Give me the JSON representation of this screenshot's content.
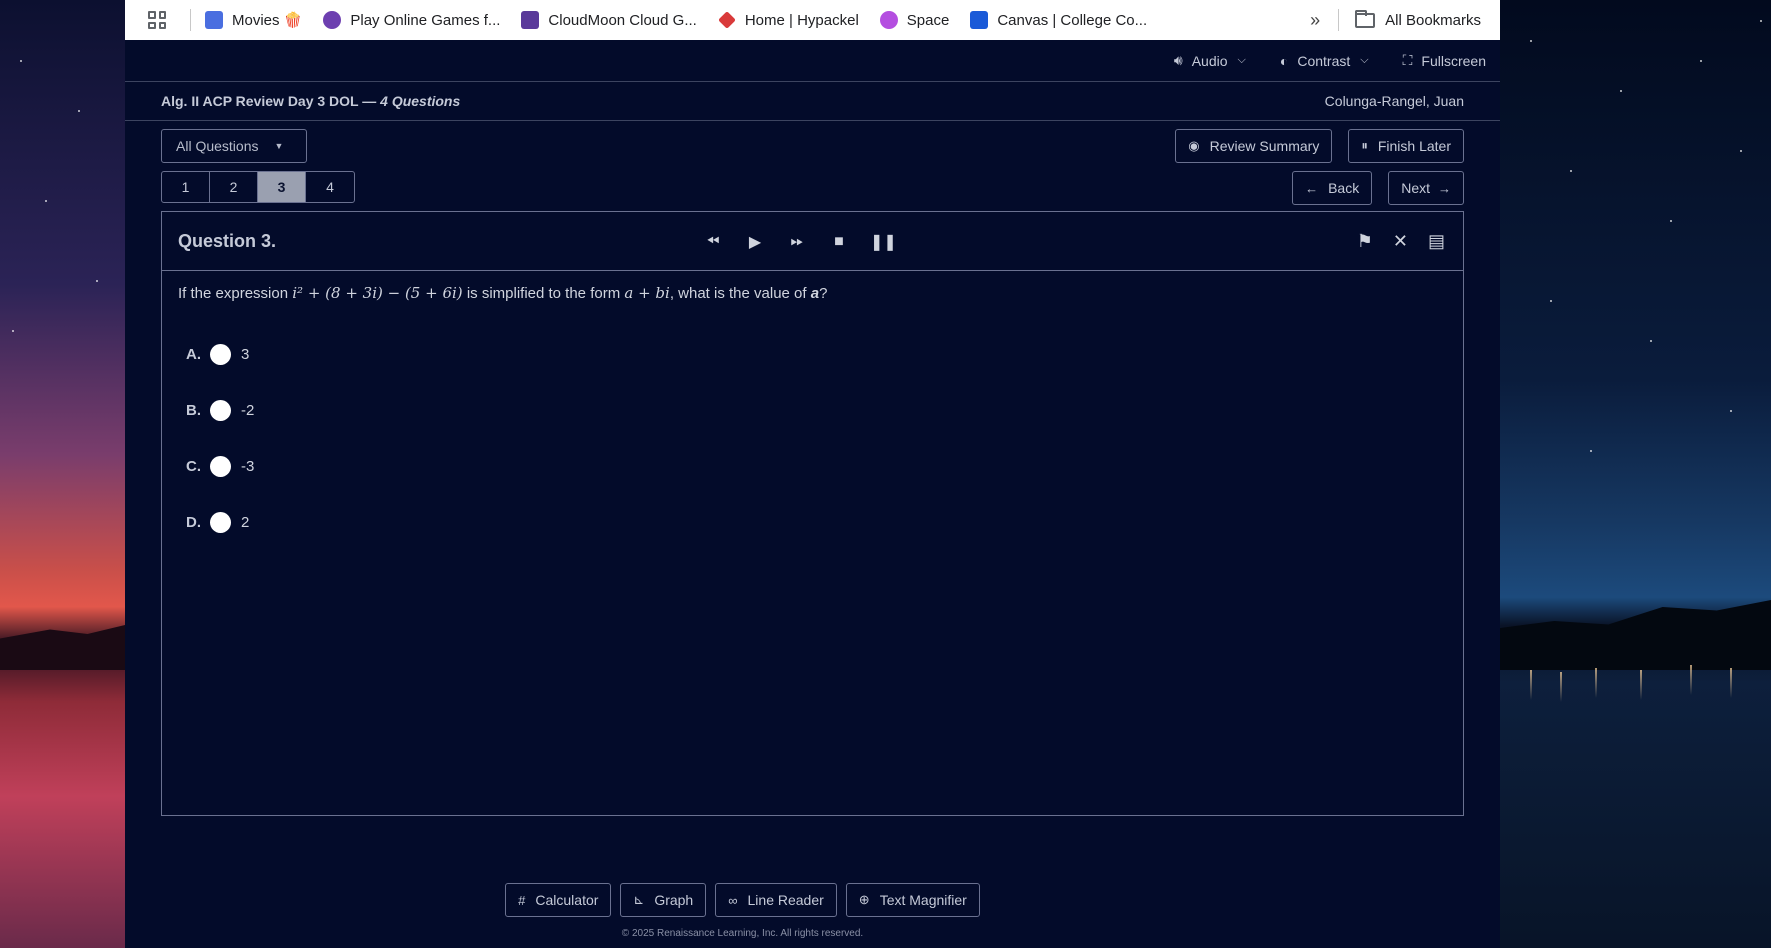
{
  "bookmarks": {
    "items": [
      {
        "label": "Movies 🍿",
        "color": "#4a6ee0"
      },
      {
        "label": "Play Online Games f...",
        "color": "#6d3fb0"
      },
      {
        "label": "CloudMoon Cloud G...",
        "color": "#5a3a9a"
      },
      {
        "label": "Home | Hypackel",
        "color": "#d93a3a"
      },
      {
        "label": "Space",
        "color": "#b44ee0"
      },
      {
        "label": "Canvas | College Co...",
        "color": "#1a5ad8"
      }
    ],
    "more": "»",
    "all_bookmarks": "All Bookmarks"
  },
  "topbar": {
    "audio": "Audio",
    "contrast": "Contrast",
    "fullscreen": "Fullscreen"
  },
  "titlebar": {
    "quiz_name": "Alg. II ACP Review Day 3 DOL — ",
    "question_count": "4 Questions",
    "student": "Colunga-Rangel, Juan"
  },
  "controls": {
    "filter": "All Questions",
    "review_summary": "Review Summary",
    "finish_later": "Finish Later",
    "back": "Back",
    "next": "Next"
  },
  "question_numbers": [
    "1",
    "2",
    "3",
    "4"
  ],
  "current_question": "3",
  "question": {
    "title": "Question 3.",
    "text_prefix": "If the expression",
    "expression": "i² + (8 + 3i) − (5 + 6i)",
    "text_middle": "is simplified to the form",
    "form": "a + bi",
    "text_suffix": ", what is the value of",
    "variable": "a",
    "end": "?",
    "options": [
      {
        "letter": "A.",
        "value": "3"
      },
      {
        "letter": "B.",
        "value": "-2"
      },
      {
        "letter": "C.",
        "value": "-3"
      },
      {
        "letter": "D.",
        "value": "2"
      }
    ]
  },
  "tools": {
    "calculator": "Calculator",
    "graph": "Graph",
    "line_reader": "Line Reader",
    "text_magnifier": "Text Magnifier"
  },
  "footer": {
    "copyright": "© 2025 Renaissance Learning, Inc. All rights reserved."
  }
}
